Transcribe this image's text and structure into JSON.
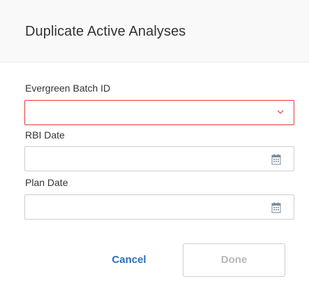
{
  "dialog": {
    "title": "Duplicate Active Analyses"
  },
  "fields": {
    "batch_id": {
      "label": "Evergreen Batch ID",
      "value": "",
      "icon": "chevron-down-icon",
      "state": "error"
    },
    "rbi_date": {
      "label": "RBI Date",
      "value": "",
      "icon": "calendar-icon"
    },
    "plan_date": {
      "label": "Plan Date",
      "value": "",
      "icon": "calendar-icon"
    }
  },
  "buttons": {
    "cancel_label": "Cancel",
    "done_label": "Done"
  },
  "colors": {
    "accent": "#2a6ebb",
    "error": "#e53935",
    "disabled_text": "#b8b8b8"
  }
}
